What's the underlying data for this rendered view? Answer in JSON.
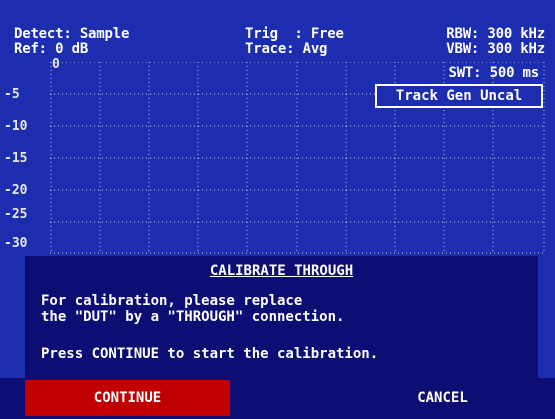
{
  "header": {
    "detect": "Detect: Sample",
    "ref": "Ref: 0 dB",
    "trig": "Trig  : Free",
    "trace": "Trace: Avg",
    "rbw": "RBW: 300 kHz",
    "vbw": "VBW: 300 kHz",
    "swt": "SWT: 500 ms"
  },
  "status_badge": "Track Gen Uncal",
  "y_axis": {
    "ticks": [
      "0",
      "-5",
      "-10",
      "-15",
      "-20",
      "-25",
      "-30"
    ]
  },
  "dialog": {
    "title": "CALIBRATE THROUGH",
    "line1": "For calibration, please replace",
    "line2": "the \"DUT\" by a \"THROUGH\" connection.",
    "line3": "Press CONTINUE to start the calibration."
  },
  "softkeys": {
    "continue_label": "CONTINUE",
    "cancel_label": "CANCEL"
  },
  "colors": {
    "background": "#1d2db0",
    "dialog": "#0c0e74",
    "active_softkey": "#c00000",
    "text": "#ffffff"
  }
}
